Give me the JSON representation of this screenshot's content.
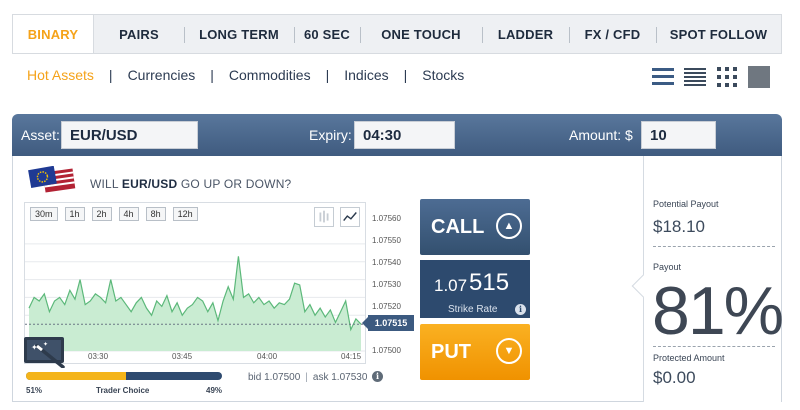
{
  "tabs": [
    {
      "label": "BINARY",
      "active": true
    },
    {
      "label": "PAIRS",
      "active": false
    },
    {
      "label": "LONG TERM",
      "active": false
    },
    {
      "label": "60 SEC",
      "active": false
    },
    {
      "label": "ONE TOUCH",
      "active": false
    },
    {
      "label": "LADDER",
      "active": false
    },
    {
      "label": "FX / CFD",
      "active": false
    },
    {
      "label": "SPOT FOLLOW",
      "active": false
    }
  ],
  "subnav": [
    {
      "label": "Hot Assets",
      "active": true
    },
    {
      "label": "Currencies",
      "active": false
    },
    {
      "label": "Commodities",
      "active": false
    },
    {
      "label": "Indices",
      "active": false
    },
    {
      "label": "Stocks",
      "active": false
    }
  ],
  "view_icons": [
    "list-view-icon",
    "compact-list-view-icon",
    "grid-view-icon",
    "tile-view-icon"
  ],
  "trade": {
    "asset_label": "Asset:",
    "asset_value": "EUR/USD",
    "expiry_label": "Expiry:",
    "expiry_value": "04:30",
    "amount_label": "Amount: $",
    "amount_value": "10"
  },
  "question": {
    "prefix": "WILL ",
    "asset": "EUR/USD",
    "suffix": " GO UP OR DOWN?"
  },
  "chart": {
    "timeframes": [
      "30m",
      "1h",
      "2h",
      "4h",
      "8h",
      "12h"
    ],
    "current_price": "1.07515"
  },
  "chart_data": {
    "type": "area",
    "y_ticks": [
      "1.07560",
      "1.07550",
      "1.07540",
      "1.07530",
      "1.07520",
      "1.07500"
    ],
    "x_ticks": [
      "03:30",
      "03:45",
      "04:00",
      "04:15"
    ],
    "ylim": [
      1.075,
      1.0757
    ],
    "color": "#5cb87a",
    "values": [
      1.07524,
      1.0753,
      1.07528,
      1.07532,
      1.07522,
      1.07528,
      1.0753,
      1.07526,
      1.07534,
      1.07529,
      1.0754,
      1.07526,
      1.07528,
      1.07532,
      1.0753,
      1.07527,
      1.0754,
      1.07528,
      1.0753,
      1.07526,
      1.07522,
      1.07527,
      1.0753,
      1.07524,
      1.0752,
      1.07528,
      1.07525,
      1.07531,
      1.07522,
      1.07527,
      1.0752,
      1.07524,
      1.07526,
      1.0753,
      1.07528,
      1.07522,
      1.07527,
      1.07517,
      1.07528,
      1.07536,
      1.07529,
      1.07553,
      1.0753,
      1.07532,
      1.07527,
      1.0753,
      1.07526,
      1.07528,
      1.07524,
      1.07527,
      1.07526,
      1.07529,
      1.07538,
      1.07537,
      1.07522,
      1.07526,
      1.0752,
      1.07524,
      1.07519,
      1.07523,
      1.07516,
      1.07522,
      1.07528,
      1.07512,
      1.07518,
      1.07515
    ]
  },
  "trader_choice": {
    "call_pct_value": 51,
    "call_pct": "51%",
    "label": "Trader Choice",
    "put_pct": "49%"
  },
  "bid": "bid 1.07500",
  "ask": "ask 1.07530",
  "call_label": "CALL",
  "put_label": "PUT",
  "strike": {
    "price_main": "1.07",
    "price_emph": "515",
    "label": "Strike Rate"
  },
  "side": {
    "potential_payout_label": "Potential Payout",
    "potential_payout_value": "$18.10",
    "payout_label": "Payout",
    "payout_value": "81%",
    "protected_label": "Protected Amount",
    "protected_value": "$0.00"
  }
}
